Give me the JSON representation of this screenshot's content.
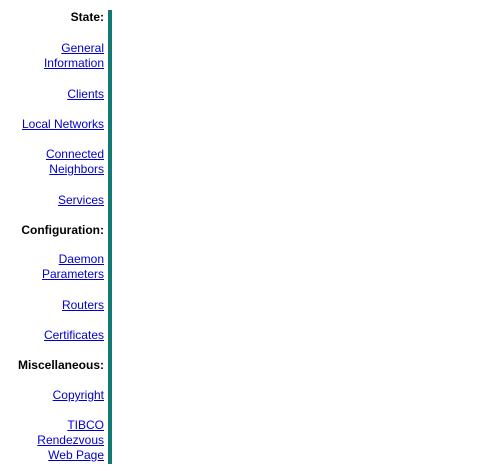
{
  "sections": {
    "state": {
      "heading": "State:",
      "links": {
        "general_information": [
          "General",
          "Information"
        ],
        "clients": [
          "Clients"
        ],
        "local_networks": [
          "Local Networks"
        ],
        "connected_neighbors": [
          "Connected",
          "Neighbors"
        ],
        "services": [
          "Services"
        ]
      }
    },
    "configuration": {
      "heading": "Configuration:",
      "links": {
        "daemon_parameters": [
          "Daemon",
          "Parameters"
        ],
        "routers": [
          "Routers"
        ],
        "certificates": [
          "Certificates"
        ]
      }
    },
    "miscellaneous": {
      "heading": "Miscellaneous:",
      "links": {
        "copyright": [
          "Copyright"
        ],
        "tibco_web_page": [
          "TIBCO",
          "Rendezvous",
          "Web Page"
        ]
      }
    }
  },
  "colors": {
    "divider": "#127a73",
    "link": "#0000cc"
  }
}
